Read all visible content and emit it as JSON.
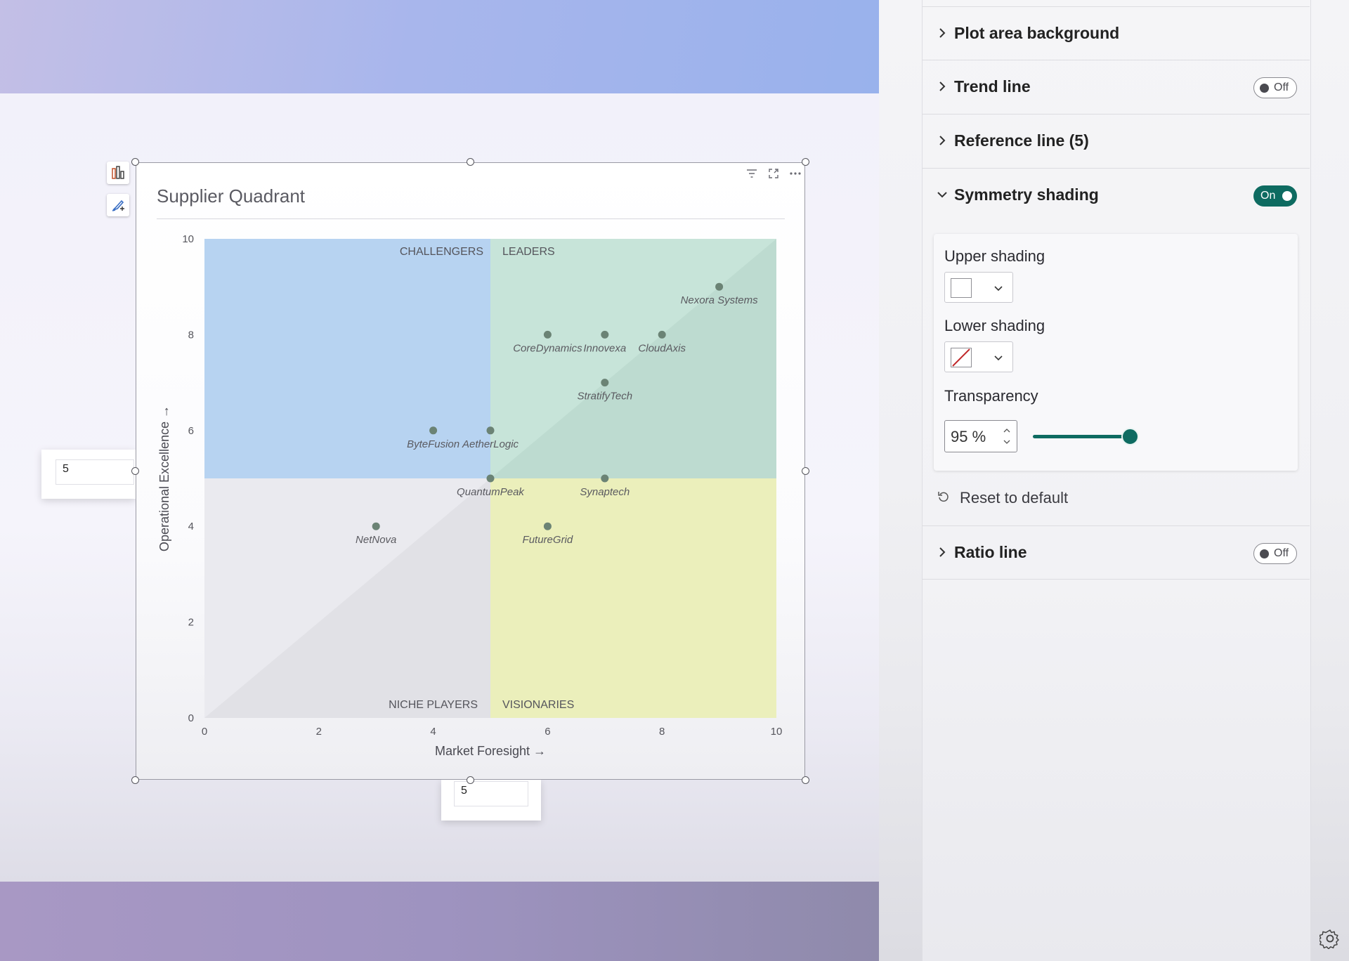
{
  "visual": {
    "title": "Supplier Quadrant",
    "x_threshold_value": "5",
    "y_threshold_value": "5"
  },
  "chart_data": {
    "type": "scatter",
    "title": "Supplier Quadrant",
    "xlabel": "Market Foresight →",
    "ylabel": "Operational Excellence →",
    "xlim": [
      0,
      10
    ],
    "ylim": [
      0,
      10
    ],
    "xticks": [
      "0",
      "2",
      "4",
      "6",
      "8",
      "10"
    ],
    "yticks": [
      "0",
      "2",
      "4",
      "6",
      "8",
      "10"
    ],
    "quadrant_threshold": {
      "x": 5,
      "y": 5
    },
    "quadrant_labels": {
      "top_left": "CHALLENGERS",
      "top_right": "LEADERS",
      "bottom_left": "NICHE PLAYERS",
      "bottom_right": "VISIONARIES"
    },
    "quadrant_colors": {
      "top_left": "#b3d1f1",
      "top_right": "#c4e3d7",
      "bottom_left": "#e9e9ee",
      "bottom_right": "#f3f7c2"
    },
    "symmetry_shading": {
      "upper": "#ffffff",
      "lower": "none",
      "transparency_percent": 95
    },
    "point_color": "#6b8375",
    "points": [
      {
        "name": "Nexora Systems",
        "x": 9,
        "y": 9
      },
      {
        "name": "CoreDynamics",
        "x": 6,
        "y": 8
      },
      {
        "name": "Innovexa",
        "x": 7,
        "y": 8
      },
      {
        "name": "CloudAxis",
        "x": 8,
        "y": 8
      },
      {
        "name": "StratifyTech",
        "x": 7,
        "y": 7
      },
      {
        "name": "ByteFusion",
        "x": 4,
        "y": 6
      },
      {
        "name": "AetherLogic",
        "x": 5,
        "y": 6
      },
      {
        "name": "QuantumPeak",
        "x": 5,
        "y": 5
      },
      {
        "name": "Synaptech",
        "x": 7,
        "y": 5
      },
      {
        "name": "NetNova",
        "x": 3,
        "y": 4
      },
      {
        "name": "FutureGrid",
        "x": 6,
        "y": 4
      }
    ]
  },
  "format_pane": {
    "sections": [
      {
        "title": "Plot area background"
      },
      {
        "title": "Trend line",
        "toggle": "Off"
      },
      {
        "title": "Reference line (5)"
      },
      {
        "title": "Symmetry shading",
        "toggle": "On"
      },
      {
        "title": "Ratio line",
        "toggle": "Off"
      }
    ],
    "symmetry": {
      "upper_label": "Upper shading",
      "lower_label": "Lower shading",
      "transparency_label": "Transparency",
      "transparency_value": "95 %",
      "transparency_level": 0.95
    },
    "reset_label": "Reset to default"
  },
  "icons": {
    "chart": "chart-icon",
    "format": "format-brush-icon",
    "filter": "filter-icon",
    "focus": "focus-mode-icon",
    "more": "more-options-icon",
    "reset": "reset-icon",
    "settings": "gear-icon"
  }
}
